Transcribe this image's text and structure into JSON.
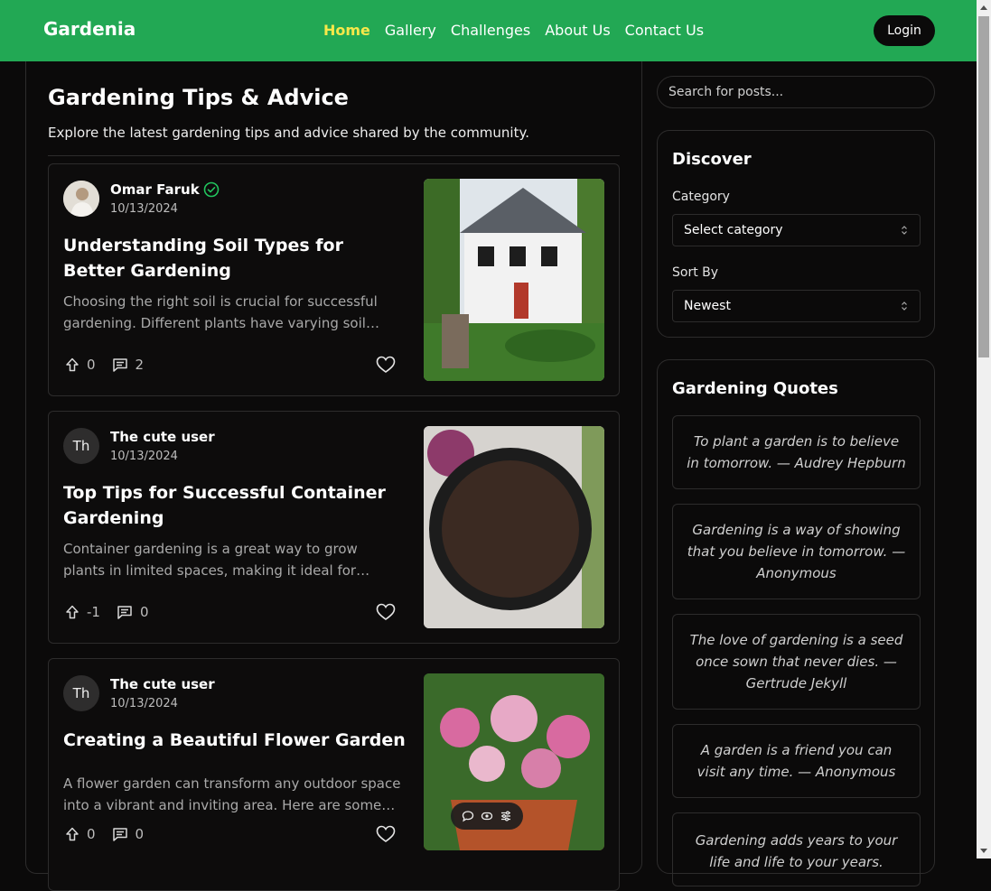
{
  "nav": {
    "brand": "Gardenia",
    "links": [
      "Home",
      "Gallery",
      "Challenges",
      "About Us",
      "Contact Us"
    ],
    "active": "Home",
    "login_label": "Login"
  },
  "main": {
    "title": "Gardening Tips & Advice",
    "subtitle": "Explore the latest gardening tips and advice shared by the community."
  },
  "posts": [
    {
      "avatar_initials": "",
      "author": "Omar Faruk",
      "verified": true,
      "date": "10/13/2024",
      "title": "Understanding Soil Types for Better Gardening",
      "excerpt": "Choosing the right soil is crucial for successful gardening. Different plants have varying soil needs, ...",
      "upvotes": "0",
      "comments": "2"
    },
    {
      "avatar_initials": "Th",
      "author": "The cute user",
      "verified": false,
      "date": "10/13/2024",
      "title": "Top Tips for Successful Container Gardening",
      "excerpt": "Container gardening is a great way to grow plants in limited spaces, making it ideal for balconies, p...",
      "upvotes": "-1",
      "comments": "0"
    },
    {
      "avatar_initials": "Th",
      "author": "The cute user",
      "verified": false,
      "date": "10/13/2024",
      "title": "Creating a Beautiful Flower Garden",
      "excerpt": "A flower garden can transform any outdoor space into a vibrant and inviting area. Here are some ti...",
      "upvotes": "0",
      "comments": "0"
    }
  ],
  "sidebar": {
    "search_placeholder": "Search for posts...",
    "discover": {
      "title": "Discover",
      "category_label": "Category",
      "category_value": "Select category",
      "sort_label": "Sort By",
      "sort_value": "Newest"
    },
    "quotes": {
      "title": "Gardening Quotes",
      "items": [
        "To plant a garden is to believe in tomorrow. — Audrey Hepburn",
        "Gardening is a way of showing that you believe in tomorrow. — Anonymous",
        "The love of gardening is a seed once sown that never dies. — Gertrude Jekyll",
        "A garden is a friend you can visit any time. — Anonymous",
        "Gardening adds years to your life and life to your years."
      ]
    }
  },
  "colors": {
    "brand_green": "#22a854",
    "active_link": "#f7e84a",
    "verified": "#22c55e"
  }
}
